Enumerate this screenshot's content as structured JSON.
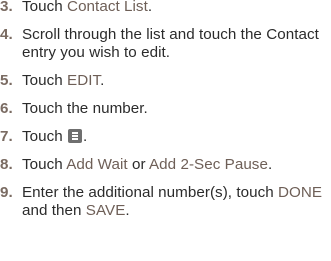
{
  "steps": [
    {
      "num": "3.",
      "parts": [
        "Touch ",
        "Contact List",
        "."
      ]
    },
    {
      "num": "4.",
      "text": "Scroll through the list and touch the Contact entry you wish to edit."
    },
    {
      "num": "5.",
      "parts": [
        "Touch ",
        "EDIT",
        "."
      ]
    },
    {
      "num": "6.",
      "text": "Touch the number."
    },
    {
      "num": "7.",
      "parts": [
        "Touch ",
        "."
      ],
      "icon": "menu-icon"
    },
    {
      "num": "8.",
      "parts": [
        "Touch ",
        "Add Wait",
        " or ",
        "Add 2-Sec Pause",
        "."
      ]
    },
    {
      "num": "9.",
      "parts": [
        "Enter the additional number(s), touch ",
        "DONE",
        " and then ",
        "SAVE",
        "."
      ]
    }
  ]
}
